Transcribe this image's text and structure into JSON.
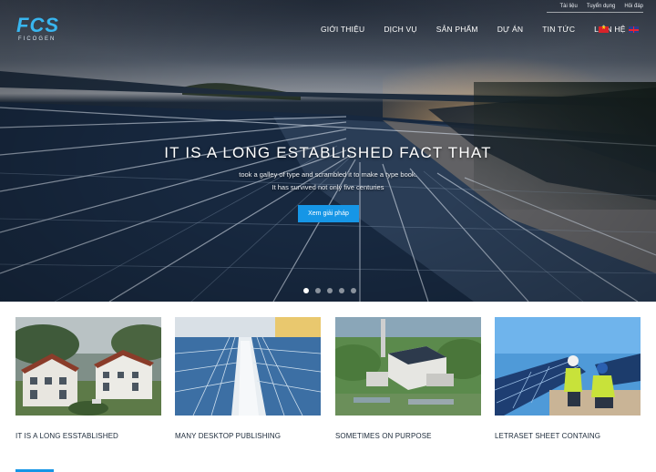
{
  "header": {
    "logo_text": "FCS",
    "logo_subtext": "FICOGEN",
    "topbar": [
      "Tài liệu",
      "Tuyển dụng",
      "Hỏi đáp"
    ],
    "nav": [
      "GIỚI THIỆU",
      "DỊCH VỤ",
      "SẢN PHẨM",
      "DỰ ÁN",
      "TIN TỨC",
      "LIÊN HỆ"
    ],
    "languages": [
      "vi-flag-icon",
      "en-flag-icon"
    ]
  },
  "hero": {
    "title": "IT IS A LONG ESTABLISHED FACT THAT",
    "line1": "took a galley of type and scrambled it to make a type book.",
    "line2": "It has survived not only five centuries",
    "button": "Xem giải pháp",
    "slide_count": 5,
    "active_slide": 1
  },
  "cards": [
    {
      "title": "IT IS A LONG ESSTABLISHED"
    },
    {
      "title": "MANY DESKTOP PUBLISHING"
    },
    {
      "title": "SOMETIMES ON PURPOSE"
    },
    {
      "title": "LETRASET SHEET CONTAING"
    }
  ],
  "colors": {
    "accent": "#1696e6",
    "logo": "#38b6f0"
  }
}
